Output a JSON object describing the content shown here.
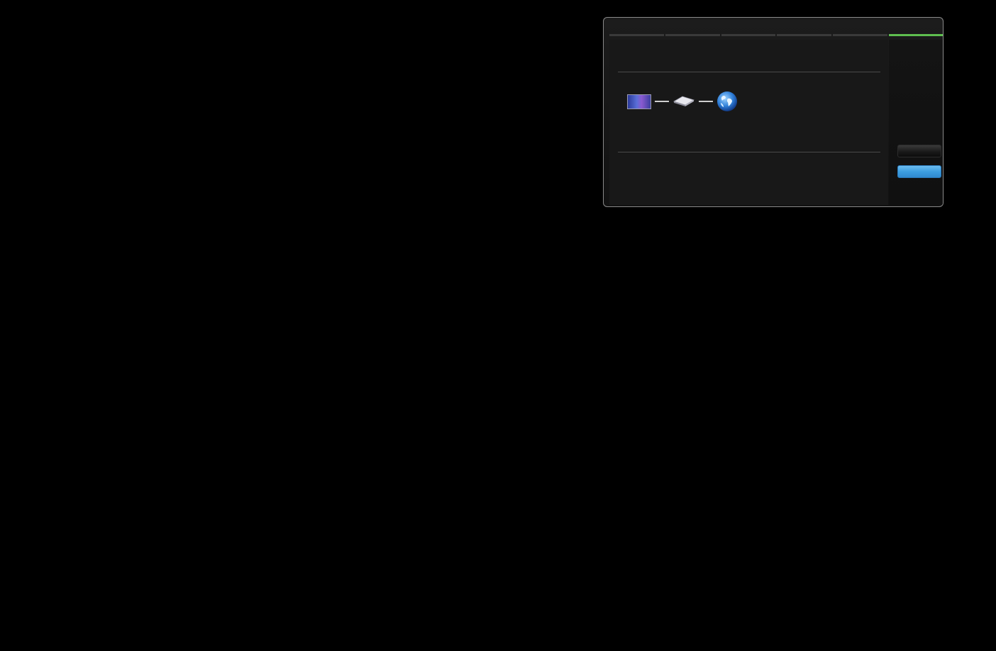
{
  "dialog": {
    "progress": {
      "total_steps": 6,
      "current_step": 6,
      "active_color": "#5fbf4f"
    },
    "diagram": {
      "nodes": [
        "tv-icon",
        "router-icon",
        "globe-icon"
      ]
    },
    "buttons": {
      "secondary_label": "",
      "primary_label": "",
      "primary_color": "#3d9ee0"
    }
  }
}
